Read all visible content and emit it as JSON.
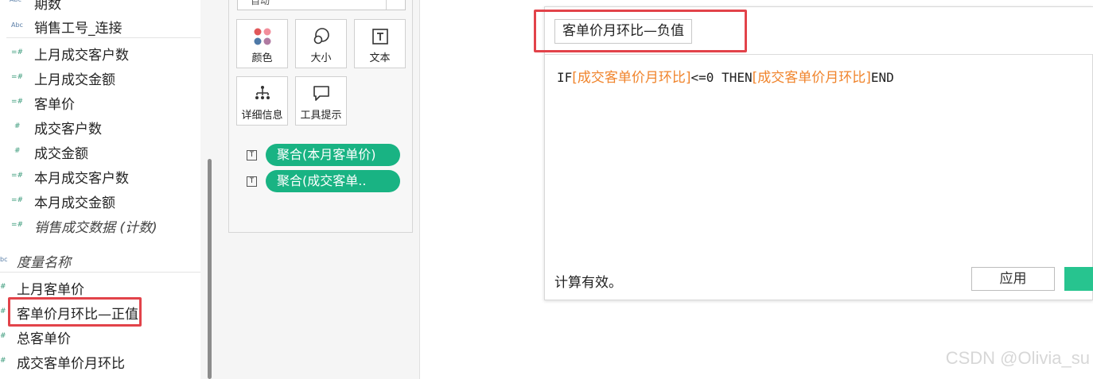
{
  "data_pane": {
    "fields": [
      {
        "icon": "Abc",
        "label": "期数"
      },
      {
        "icon": "Abc",
        "label": "销售工号_连接"
      },
      {
        "icon": "=#",
        "label": "上月成交客户数"
      },
      {
        "icon": "=#",
        "label": "上月成交金额"
      },
      {
        "icon": "=#",
        "label": "客单价"
      },
      {
        "icon": "#",
        "label": "成交客户数"
      },
      {
        "icon": "#",
        "label": "成交金额"
      },
      {
        "icon": "=#",
        "label": "本月成交客户数"
      },
      {
        "icon": "=#",
        "label": "本月成交金额"
      },
      {
        "icon": "=#",
        "label": "销售成交数据 (计数)"
      }
    ],
    "measure_names": {
      "icon": "bc",
      "label": "度量名称"
    },
    "calc_fields": [
      {
        "icon": "#",
        "label": "上月客单价"
      },
      {
        "icon": "#",
        "label": "客单价月环比—正值"
      },
      {
        "icon": "#",
        "label": "总客单价"
      },
      {
        "icon": "#",
        "label": "成交客单价月环比"
      }
    ]
  },
  "marks": {
    "dropdown_value": "自动",
    "buttons": [
      {
        "label": "颜色",
        "icon": "color-icon"
      },
      {
        "label": "大小",
        "icon": "size-icon"
      },
      {
        "label": "文本",
        "icon": "text-icon"
      },
      {
        "label": "详细信息",
        "icon": "detail-icon"
      },
      {
        "label": "工具提示",
        "icon": "tooltip-icon"
      }
    ],
    "pills": [
      {
        "type_icon": "T",
        "label": "聚合(本月客单价)"
      },
      {
        "type_icon": "T",
        "label": "聚合(成交客单.."
      }
    ]
  },
  "calc_dialog": {
    "name": "客单价月环比—负值",
    "formula": {
      "kw_if": "IF",
      "field1": "[成交客单价月环比]",
      "op": "<=0 THEN",
      "field2": "[成交客单价月环比]",
      "kw_end": "END"
    },
    "status": "计算有效。",
    "apply_label": "应用"
  },
  "watermark": "CSDN @Olivia_su",
  "colors": {
    "pill": "#19b383",
    "highlight": "#e2434a",
    "field_ref": "#f0842c",
    "ok_button": "#27c48f"
  }
}
